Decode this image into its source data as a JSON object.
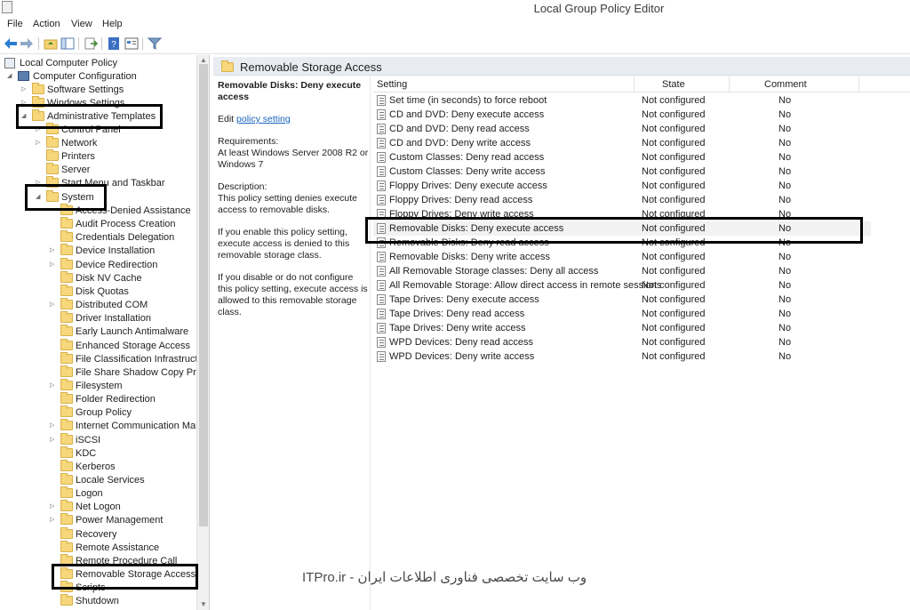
{
  "window": {
    "title": "Local Group Policy Editor"
  },
  "menu": [
    "File",
    "Action",
    "View",
    "Help"
  ],
  "toolbar_icons": [
    "back-arrow-icon",
    "forward-arrow-icon",
    "up-folder-icon",
    "show-hide-tree-icon",
    "export-list-icon",
    "help-icon",
    "properties-icon",
    "filter-icon"
  ],
  "tree": {
    "root": "Local Computer Policy",
    "computer_config": "Computer Configuration",
    "software_settings": "Software Settings",
    "windows_settings": "Windows Settings",
    "admin_templates": "Administrative Templates",
    "admin_children": [
      "Control Panel",
      "Network",
      "Printers",
      "Server",
      "Start Menu and Taskbar"
    ],
    "system": "System",
    "system_children": [
      "Access-Denied Assistance",
      "Audit Process Creation",
      "Credentials Delegation",
      "Device Installation",
      "Device Redirection",
      "Disk NV Cache",
      "Disk Quotas",
      "Distributed COM",
      "Driver Installation",
      "Early Launch Antimalware",
      "Enhanced Storage Access",
      "File Classification Infrastructure",
      "File Share Shadow Copy Provider",
      "Filesystem",
      "Folder Redirection",
      "Group Policy",
      "Internet Communication Management",
      "iSCSI",
      "KDC",
      "Kerberos",
      "Locale Services",
      "Logon",
      "Net Logon",
      "Power Management",
      "Recovery",
      "Remote Assistance",
      "Remote Procedure Call",
      "Removable Storage Access",
      "Scripts",
      "Shutdown"
    ]
  },
  "panel": {
    "header": "Removable Storage Access",
    "desc_title": "Removable Disks: Deny execute access",
    "edit_prefix": "Edit",
    "edit_link": "policy setting",
    "requirements_label": "Requirements:",
    "requirements_text": "At least Windows Server 2008 R2 or Windows 7",
    "description_label": "Description:",
    "description_text": "This policy setting denies execute access to removable disks.",
    "enable_text": "If you enable this policy setting, execute access is denied to this removable storage class.",
    "disable_text": "If you disable or do not configure this policy setting, execute access is allowed to this removable storage class.",
    "columns": {
      "setting": "Setting",
      "state": "State",
      "comment": "Comment"
    },
    "rows": [
      {
        "setting": "Set time (in seconds) to force reboot",
        "state": "Not configured",
        "comment": "No"
      },
      {
        "setting": "CD and DVD: Deny execute access",
        "state": "Not configured",
        "comment": "No"
      },
      {
        "setting": "CD and DVD: Deny read access",
        "state": "Not configured",
        "comment": "No"
      },
      {
        "setting": "CD and DVD: Deny write access",
        "state": "Not configured",
        "comment": "No"
      },
      {
        "setting": "Custom Classes: Deny read access",
        "state": "Not configured",
        "comment": "No"
      },
      {
        "setting": "Custom Classes: Deny write access",
        "state": "Not configured",
        "comment": "No"
      },
      {
        "setting": "Floppy Drives: Deny execute access",
        "state": "Not configured",
        "comment": "No"
      },
      {
        "setting": "Floppy Drives: Deny read access",
        "state": "Not configured",
        "comment": "No"
      },
      {
        "setting": "Floppy Drives: Deny write access",
        "state": "Not configured",
        "comment": "No"
      },
      {
        "setting": "Removable Disks: Deny execute access",
        "state": "Not configured",
        "comment": "No"
      },
      {
        "setting": "Removable Disks: Deny read access",
        "state": "Not configured",
        "comment": "No"
      },
      {
        "setting": "Removable Disks: Deny write access",
        "state": "Not configured",
        "comment": "No"
      },
      {
        "setting": "All Removable Storage classes: Deny all access",
        "state": "Not configured",
        "comment": "No"
      },
      {
        "setting": "All Removable Storage: Allow direct access in remote sessions",
        "state": "Not configured",
        "comment": "No"
      },
      {
        "setting": "Tape Drives: Deny execute access",
        "state": "Not configured",
        "comment": "No"
      },
      {
        "setting": "Tape Drives: Deny read access",
        "state": "Not configured",
        "comment": "No"
      },
      {
        "setting": "Tape Drives: Deny write access",
        "state": "Not configured",
        "comment": "No"
      },
      {
        "setting": "WPD Devices: Deny read access",
        "state": "Not configured",
        "comment": "No"
      },
      {
        "setting": "WPD Devices: Deny write access",
        "state": "Not configured",
        "comment": "No"
      }
    ]
  },
  "watermark": "ITPro.ir - وب سایت تخصصی فناوری اطلاعات ایران"
}
